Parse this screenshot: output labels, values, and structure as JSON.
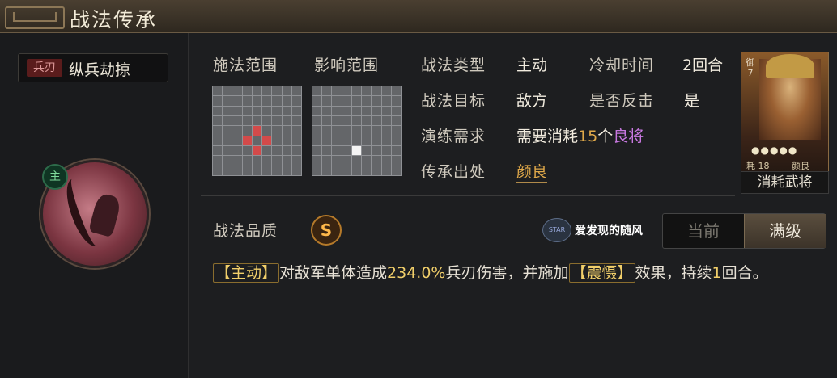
{
  "header": {
    "title": "战法传承"
  },
  "skill": {
    "type_tag": "兵刃",
    "name": "纵兵劫掠",
    "badge": "主",
    "icon": "crimson-halberd-icon"
  },
  "ranges": {
    "cast_label": "施法范围",
    "effect_label": "影响范围",
    "cast_grid_red_cells": [
      [
        5,
        3
      ],
      [
        6,
        4
      ],
      [
        4,
        4
      ],
      [
        5,
        5
      ]
    ],
    "effect_grid_white_cells": [
      [
        6,
        4
      ]
    ]
  },
  "info": {
    "type_label": "战法类型",
    "type_value": "主动",
    "cooldown_label": "冷却时间",
    "cooldown_value": "2回合",
    "target_label": "战法目标",
    "target_value": "敌方",
    "counter_label": "是否反击",
    "counter_value": "是",
    "req_label": "演练需求",
    "req_prefix": "需要消耗",
    "req_count": "15",
    "req_unit": "个",
    "req_item": "良将",
    "origin_label": "传承出处",
    "origin_value": "颜良"
  },
  "general_card": {
    "rank": "御7",
    "stars": "●●●●●",
    "cost": "耗 18",
    "name": "颜良",
    "consume_label": "消耗武将"
  },
  "quality": {
    "label": "战法品质",
    "grade": "S"
  },
  "watermark": {
    "logo": "STAR",
    "text": "爱发现的随风"
  },
  "toggle": {
    "current": "当前",
    "max": "满级",
    "selected": "满级"
  },
  "description": {
    "tag1": "【主动】",
    "part1": "对敌军单体造成",
    "value": "234.0%",
    "part2": "兵刃伤害，并施加",
    "tag2": "【震慑】",
    "part3": "效果，持续",
    "duration": "1",
    "part4": "回合。"
  },
  "colors": {
    "gold": "#e0a94a",
    "purple": "#c878e0",
    "red_cell": "#d34a4a"
  }
}
